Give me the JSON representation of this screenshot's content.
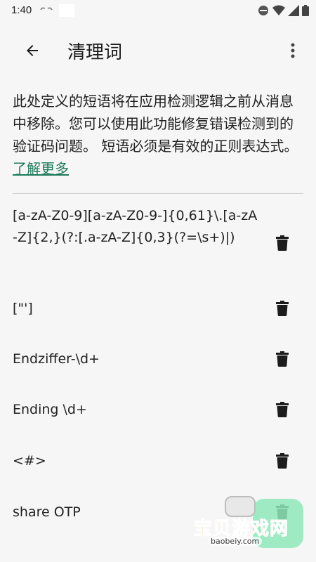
{
  "status_bar": {
    "time": "1:40"
  },
  "app_bar": {
    "title": "清理词"
  },
  "description": {
    "text": "此处定义的短语将在应用检测逻辑之前从消息中移除。您可以使用此功能修复错误检测到的验证码问题。 短语必须是有效的正则表达式。",
    "learn_more": "了解更多"
  },
  "rules": [
    "[a-zA-Z0-9][a-zA-Z0-9-]{0,61}\\.[a-zA-Z]{2,}(?:[.a-zA-Z]{0,3}(?=\\s+)|)",
    "[\"']",
    "Endziffer-\\d+",
    "Ending \\d+",
    "<#>",
    "share OTP"
  ],
  "watermark": {
    "name": "宝贝游戏网",
    "url": "baobeiy.com"
  },
  "colors": {
    "background": "#f6f6f6",
    "link": "#1c7a5a",
    "icon": "#1c1c1c"
  }
}
